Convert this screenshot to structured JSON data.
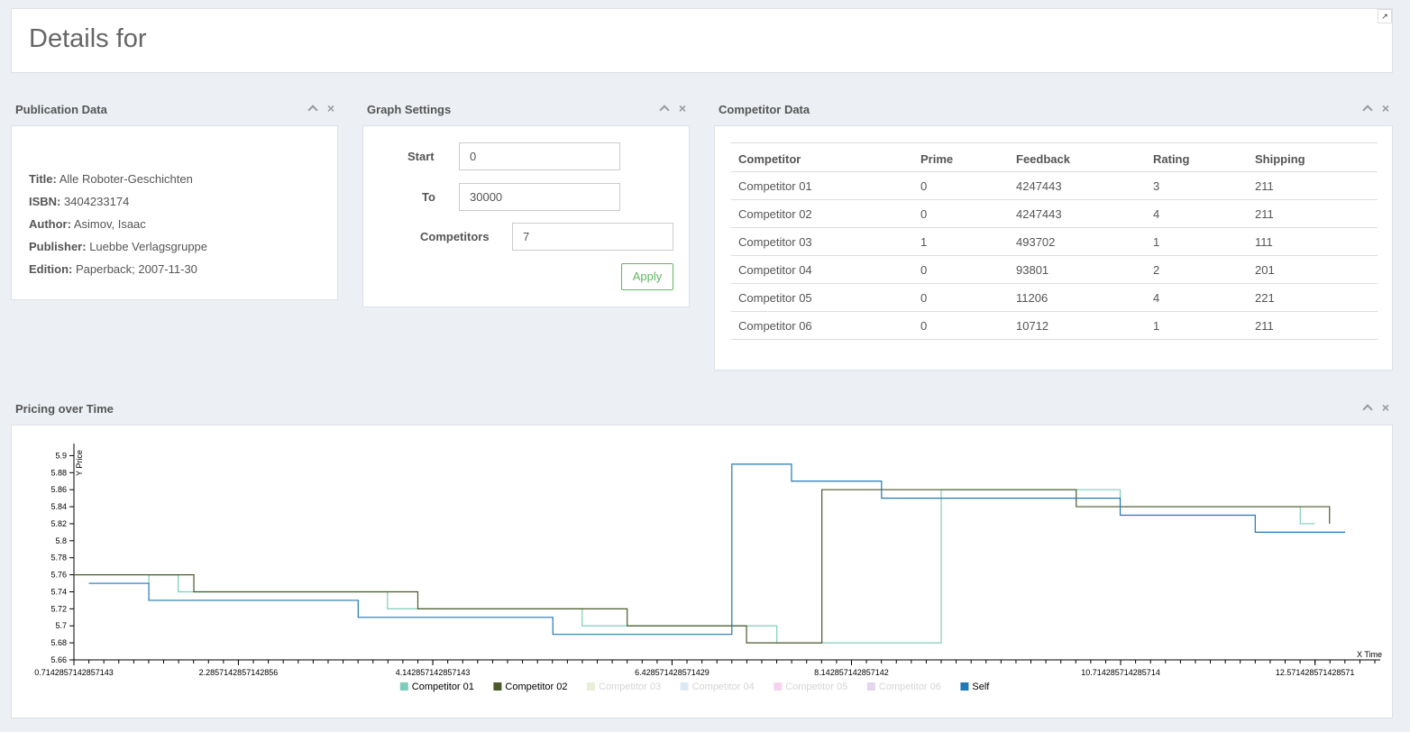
{
  "header": {
    "title": "Details for",
    "expand_icon": "↗"
  },
  "panels": {
    "publication": "Publication Data",
    "graph": "Graph Settings",
    "competitor": "Competitor Data",
    "pricing": "Pricing over Time"
  },
  "publication": {
    "rows": [
      {
        "label": "Title:",
        "value": " Alle Roboter-Geschichten"
      },
      {
        "label": "ISBN:",
        "value": " 3404233174"
      },
      {
        "label": "Author:",
        "value": " Asimov, Isaac"
      },
      {
        "label": "Publisher:",
        "value": " Luebbe Verlagsgruppe"
      },
      {
        "label": "Edition:",
        "value": " Paperback; 2007-11-30"
      }
    ]
  },
  "graph_settings": {
    "start_label": "Start",
    "start_value": "0",
    "to_label": "To",
    "to_value": "30000",
    "competitors_label": "Competitors",
    "competitors_value": "7",
    "apply_label": "Apply"
  },
  "competitor_table": {
    "headers": [
      "Competitor",
      "Prime",
      "Feedback",
      "Rating",
      "Shipping"
    ],
    "rows": [
      [
        "Competitor 01",
        "0",
        "4247443",
        "3",
        "211"
      ],
      [
        "Competitor 02",
        "0",
        "4247443",
        "4",
        "211"
      ],
      [
        "Competitor 03",
        "1",
        "493702",
        "1",
        "111"
      ],
      [
        "Competitor 04",
        "0",
        "93801",
        "2",
        "201"
      ],
      [
        "Competitor 05",
        "0",
        "11206",
        "4",
        "221"
      ],
      [
        "Competitor 06",
        "0",
        "10712",
        "1",
        "211"
      ]
    ]
  },
  "chart_data": {
    "type": "line",
    "xlabel": "X Time",
    "ylabel": "Y Price",
    "xlim": [
      0.7142857142857143,
      13.142857142857142
    ],
    "ylim": [
      5.66,
      5.91
    ],
    "yticks": [
      5.66,
      5.68,
      5.7,
      5.72,
      5.74,
      5.76,
      5.78,
      5.8,
      5.82,
      5.84,
      5.86,
      5.88,
      5.9
    ],
    "xtick_labels": [
      {
        "x": 0.7142857142857143,
        "label": "0.7142857142857143"
      },
      {
        "x": 2.2857142857142856,
        "label": "2.2857142857142856"
      },
      {
        "x": 4.142857142857143,
        "label": "4.142857142857143"
      },
      {
        "x": 6.428571428571429,
        "label": "6.428571428571429"
      },
      {
        "x": 8.142857142857142,
        "label": "8.142857142857142"
      },
      {
        "x": 10.714285714285714,
        "label": "10.714285714285714"
      },
      {
        "x": 12.571428571428571,
        "label": "12.571428571428571"
      }
    ],
    "legend_position": "bottom-center",
    "series": [
      {
        "name": "Competitor 01",
        "color": "#7fcdbb",
        "visible": true,
        "points": [
          [
            0.857,
            5.75
          ],
          [
            1.43,
            5.76
          ],
          [
            1.71,
            5.74
          ],
          [
            3.71,
            5.72
          ],
          [
            4.14,
            5.72
          ],
          [
            5.57,
            5.7
          ],
          [
            7.14,
            5.7
          ],
          [
            7.43,
            5.68
          ],
          [
            8.14,
            5.68
          ],
          [
            9.0,
            5.86
          ],
          [
            10.71,
            5.84
          ],
          [
            12.43,
            5.82
          ],
          [
            12.57,
            5.82
          ]
        ]
      },
      {
        "name": "Competitor 02",
        "color": "#4a5a2a",
        "visible": true,
        "points": [
          [
            0.714,
            5.76
          ],
          [
            1.86,
            5.74
          ],
          [
            4.0,
            5.72
          ],
          [
            6.0,
            5.7
          ],
          [
            7.14,
            5.68
          ],
          [
            7.86,
            5.86
          ],
          [
            10.29,
            5.84
          ],
          [
            12.71,
            5.82
          ]
        ]
      },
      {
        "name": "Competitor 03",
        "color": "#e5f0d6",
        "visible": false,
        "points": []
      },
      {
        "name": "Competitor 04",
        "color": "#dbe9f6",
        "visible": false,
        "points": []
      },
      {
        "name": "Competitor 05",
        "color": "#f5d5ee",
        "visible": false,
        "points": []
      },
      {
        "name": "Competitor 06",
        "color": "#e2d6ed",
        "visible": false,
        "points": []
      },
      {
        "name": "Self",
        "color": "#2078b4",
        "visible": true,
        "points": [
          [
            0.857,
            5.75
          ],
          [
            1.43,
            5.73
          ],
          [
            3.43,
            5.71
          ],
          [
            5.29,
            5.69
          ],
          [
            7.0,
            5.89
          ],
          [
            7.57,
            5.87
          ],
          [
            8.43,
            5.85
          ],
          [
            10.71,
            5.83
          ],
          [
            12.0,
            5.81
          ],
          [
            12.86,
            5.81
          ]
        ]
      }
    ]
  }
}
